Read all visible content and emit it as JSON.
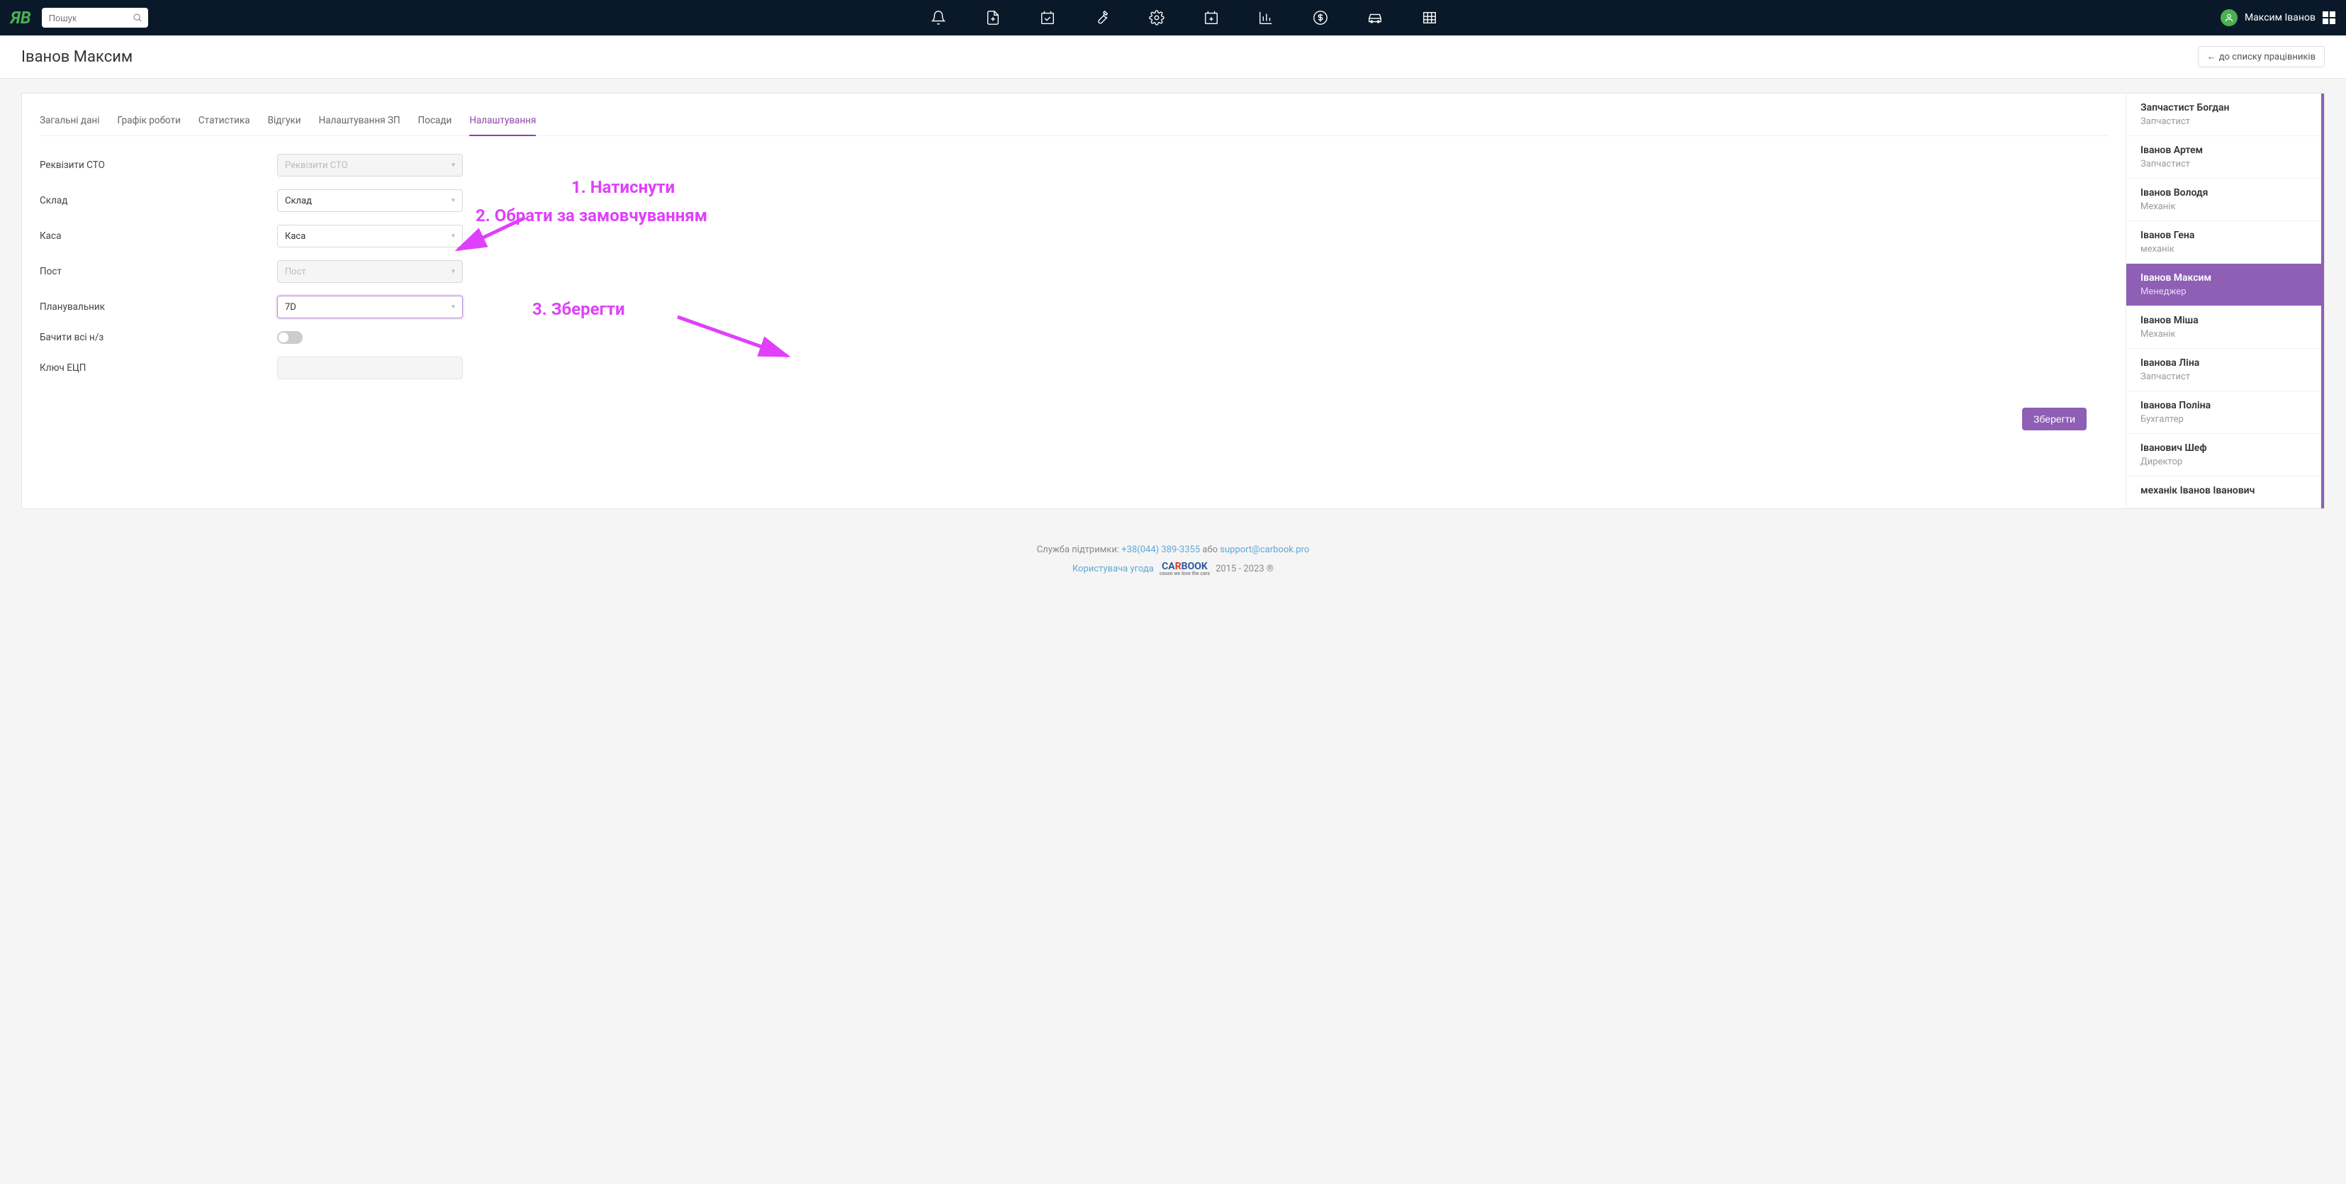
{
  "header": {
    "search_placeholder": "Пошук",
    "user_name": "Максим Іванов"
  },
  "page": {
    "title": "Іванов Максим",
    "back_link": "до списку працівників"
  },
  "tabs": [
    "Загальні дані",
    "Графік роботи",
    "Статистика",
    "Відгуки",
    "Налаштування ЗП",
    "Посади",
    "Налаштування"
  ],
  "form": {
    "requisites": {
      "label": "Реквізити СТО",
      "placeholder": "Реквізити СТО"
    },
    "warehouse": {
      "label": "Склад",
      "value": "Склад"
    },
    "cashbox": {
      "label": "Каса",
      "value": "Каса"
    },
    "post": {
      "label": "Пост",
      "placeholder": "Пост"
    },
    "planner": {
      "label": "Планувальник",
      "value": "7D"
    },
    "see_all": {
      "label": "Бачити всі н/з"
    },
    "ecp_key": {
      "label": "Ключ ЕЦП"
    },
    "save": "Зберегти"
  },
  "annotations": {
    "a1": "1. Натиснути",
    "a2": "2. Обрати за замовчуванням",
    "a3": "3. Зберегти"
  },
  "employees": [
    {
      "name": "Запчастист Богдан",
      "role": "Запчастист"
    },
    {
      "name": "Іванов Артем",
      "role": "Запчастист"
    },
    {
      "name": "Іванов Володя",
      "role": "Механік"
    },
    {
      "name": "Іванов Гена",
      "role": "механік"
    },
    {
      "name": "Іванов Максим",
      "role": "Менеджер",
      "active": true
    },
    {
      "name": "Іванов Міша",
      "role": "Механік"
    },
    {
      "name": "Іванова Ліна",
      "role": "Запчастист"
    },
    {
      "name": "Іванова Поліна",
      "role": "Бухгалтер"
    },
    {
      "name": "Іванович Шеф",
      "role": "Директор"
    },
    {
      "name": "механік Іванов Іванович",
      "role": ""
    }
  ],
  "footer": {
    "support_label": "Служба підтримки:",
    "phone": "+38(044) 389-3355",
    "or": "або",
    "email": "support@carbook.pro",
    "agreement": "Користувача угода",
    "years": "2015 - 2023 ®"
  }
}
